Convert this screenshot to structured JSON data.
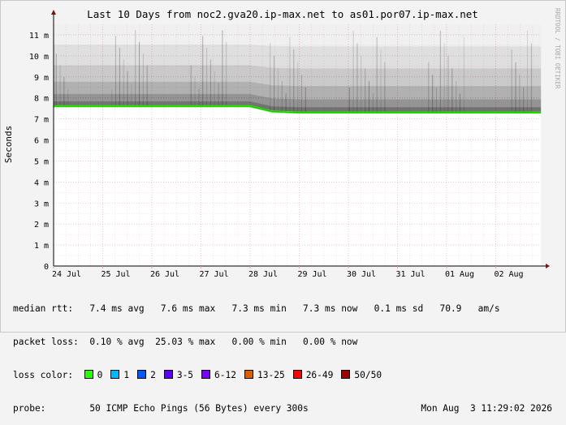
{
  "chart_data": {
    "type": "line",
    "title": "Last 10 Days from noc2.gva20.ip-max.net to as01.por07.ip-max.net",
    "ylabel": "Seconds",
    "xlabel": "",
    "ylim": [
      0,
      11.5
    ],
    "y_ticks": [
      {
        "value": 0,
        "label": "0"
      },
      {
        "value": 1,
        "label": "1 m"
      },
      {
        "value": 2,
        "label": "2 m"
      },
      {
        "value": 3,
        "label": "3 m"
      },
      {
        "value": 4,
        "label": "4 m"
      },
      {
        "value": 5,
        "label": "5 m"
      },
      {
        "value": 6,
        "label": "6 m"
      },
      {
        "value": 7,
        "label": "7 m"
      },
      {
        "value": 8,
        "label": "8 m"
      },
      {
        "value": 9,
        "label": "9 m"
      },
      {
        "value": 10,
        "label": "10 m"
      },
      {
        "value": 11,
        "label": "11 m"
      }
    ],
    "x_ticks": [
      "24 Jul",
      "25 Jul",
      "26 Jul",
      "27 Jul",
      "28 Jul",
      "29 Jul",
      "30 Jul",
      "31 Jul",
      "01 Aug",
      "02 Aug"
    ],
    "grid": true,
    "series": [
      {
        "name": "median rtt",
        "x": [
          "24 Jul",
          "25 Jul",
          "26 Jul",
          "27 Jul",
          "28 Jul",
          "28 Jul",
          "29 Jul",
          "30 Jul",
          "31 Jul",
          "01 Aug",
          "02 Aug",
          "03 Aug"
        ],
        "values": [
          7.6,
          7.6,
          7.6,
          7.6,
          7.6,
          7.35,
          7.3,
          7.3,
          7.3,
          7.3,
          7.3,
          7.3
        ]
      }
    ],
    "smoke_range": [
      7.3,
      11.5
    ],
    "watermark": "RRDTOOL / TOBI OETIKER"
  },
  "legend": {
    "median": {
      "label": "median rtt:",
      "avg": "7.4 ms avg",
      "max": "7.6 ms max",
      "min": "7.3 ms min",
      "now": "7.3 ms now",
      "sd": "0.1 ms sd",
      "amps": "70.9   am/s"
    },
    "loss": {
      "label": "packet loss:",
      "avg": "0.10 % avg",
      "max": "25.03 % max",
      "min": "0.00 % min",
      "now": "0.00 % now"
    },
    "loss_color": {
      "label": "loss color:",
      "items": [
        {
          "label": "0",
          "color": "#26ff00"
        },
        {
          "label": "1",
          "color": "#00b8ff"
        },
        {
          "label": "2",
          "color": "#0059ff"
        },
        {
          "label": "3-5",
          "color": "#5e00ff"
        },
        {
          "label": "6-12",
          "color": "#7e00ff"
        },
        {
          "label": "13-25",
          "color": "#dd5d00"
        },
        {
          "label": "26-49",
          "color": "#ff0000"
        },
        {
          "label": "50/50",
          "color": "#a10000"
        }
      ]
    },
    "probe": {
      "label": "probe:",
      "text": "50 ICMP Echo Pings (56 Bytes) every 300s",
      "date": "Mon Aug  3 11:29:02 2026"
    }
  }
}
